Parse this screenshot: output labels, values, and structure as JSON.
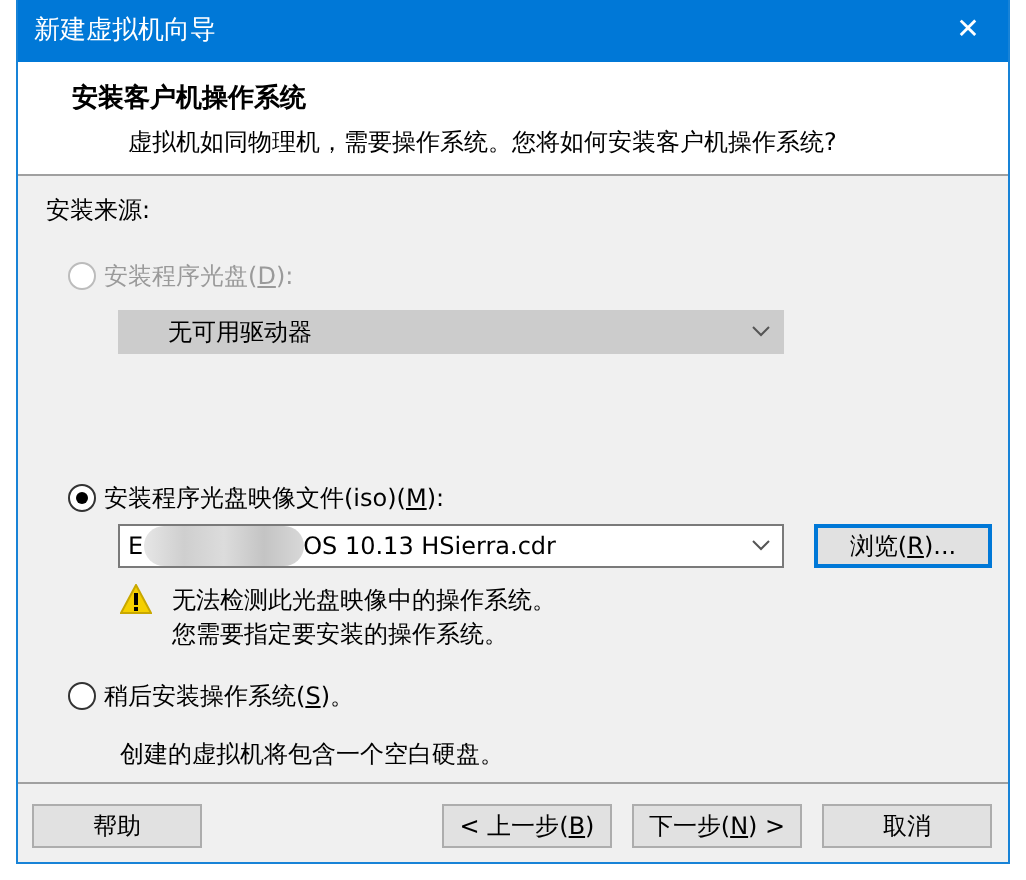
{
  "window": {
    "title": "新建虚拟机向导",
    "close_glyph": "✕"
  },
  "header": {
    "title": "安装客户机操作系统",
    "subtitle": "虚拟机如同物理机，需要操作系统。您将如何安装客户机操作系统?"
  },
  "source": {
    "label": "安装来源:",
    "options": [
      {
        "kind": "drive",
        "label": [
          "安装程序光盘(",
          "D",
          "):"
        ],
        "selected": false,
        "disabled": true,
        "dropdown": {
          "value": "无可用驱动器",
          "disabled": true
        }
      },
      {
        "kind": "image",
        "label": [
          "安装程序光盘映像文件(iso)(",
          "M",
          "):"
        ],
        "selected": true,
        "disabled": false,
        "field": {
          "value_start": "E",
          "value_end": "OS 10.13 HSierra.cdr",
          "redacted": true
        },
        "browse": [
          "浏览(",
          "R",
          ")..."
        ],
        "warning": [
          "无法检测此光盘映像中的操作系统。",
          "您需要指定要安装的操作系统。"
        ]
      },
      {
        "kind": "later",
        "label": [
          "稍后安装操作系统(",
          "S",
          ")。"
        ],
        "selected": false,
        "disabled": false,
        "note": "创建的虚拟机将包含一个空白硬盘。"
      }
    ]
  },
  "buttons": [
    {
      "kind": "help",
      "label": [
        "帮助"
      ]
    },
    {
      "kind": "back",
      "label": [
        "< 上一步(",
        "B",
        ")"
      ]
    },
    {
      "kind": "next",
      "label": [
        "下一步(",
        "N",
        ") >"
      ]
    },
    {
      "kind": "cancel",
      "label": [
        "取消"
      ]
    }
  ]
}
